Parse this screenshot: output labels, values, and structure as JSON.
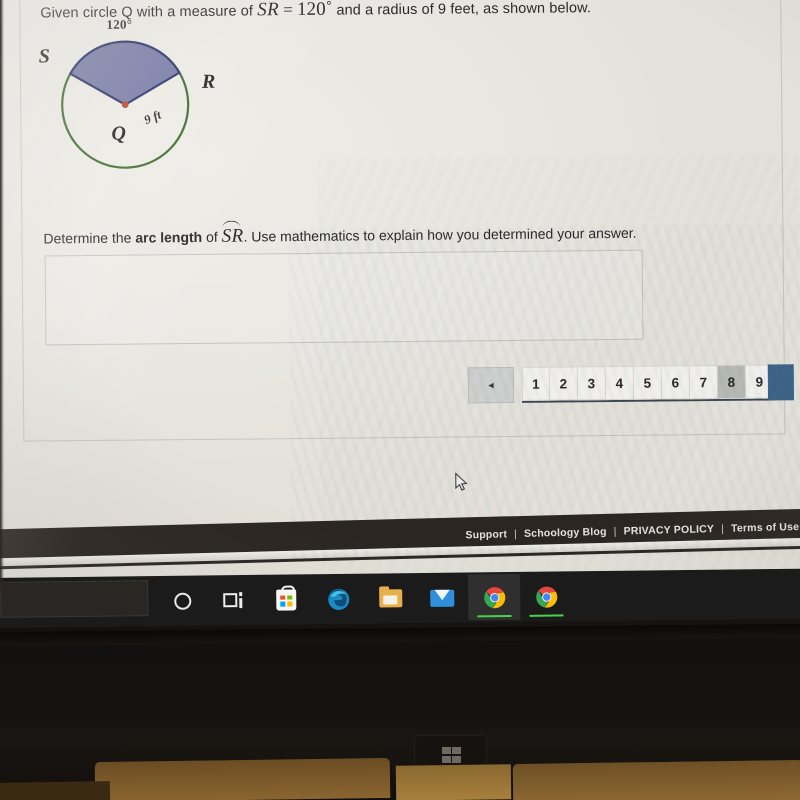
{
  "question": {
    "stem_prefix": "Given circle Q with a measure of",
    "stem_arc_var": "SR",
    "stem_equals": "=",
    "stem_value": "120",
    "stem_degree": "˚",
    "stem_suffix": "and a radius of 9 feet, as shown below.",
    "prompt_prefix": "Determine the",
    "prompt_bold": "arc length",
    "prompt_of": "of",
    "prompt_arc_var": "SR",
    "prompt_suffix": ". Use mathematics to explain how you determined your answer.",
    "answer_placeholder": ""
  },
  "diagram": {
    "angle_label": "120°",
    "point_s": "S",
    "point_r": "R",
    "center_q": "Q",
    "radius_label": "9 ft",
    "circle_stroke_color": "#3f6b2e",
    "sector_fill_color": "#6b6f9e",
    "sector_stroke_color": "#2b3166",
    "center_dot_color": "#b8462a",
    "radius_feet": 9,
    "central_angle_degrees": 120
  },
  "pagination": {
    "prev_icon": "◄",
    "pages": [
      "1",
      "2",
      "3",
      "4",
      "5",
      "6",
      "7",
      "8",
      "9"
    ],
    "current_page": "8",
    "next_button_color": "#3d6487"
  },
  "footer": {
    "links": [
      "Support",
      "Schoology Blog",
      "PRIVACY POLICY",
      "Terms of Use"
    ],
    "separator": "|"
  },
  "taskbar": {
    "search_placeholder": "",
    "items": [
      {
        "name": "cortana-icon",
        "label": "Cortana",
        "active": false,
        "running": false
      },
      {
        "name": "task-view-icon",
        "label": "Task View",
        "active": false,
        "running": false
      },
      {
        "name": "store-icon",
        "label": "Microsoft Store",
        "active": false,
        "running": false
      },
      {
        "name": "edge-icon",
        "label": "Microsoft Edge",
        "active": false,
        "running": false
      },
      {
        "name": "file-explorer-icon",
        "label": "File Explorer",
        "active": false,
        "running": false
      },
      {
        "name": "mail-icon",
        "label": "Mail",
        "active": false,
        "running": false
      },
      {
        "name": "chrome-icon",
        "label": "Google Chrome",
        "active": true,
        "running": true
      },
      {
        "name": "chrome-icon",
        "label": "Google Chrome",
        "active": false,
        "running": true
      }
    ]
  },
  "device": {
    "windows_key_label": ""
  }
}
